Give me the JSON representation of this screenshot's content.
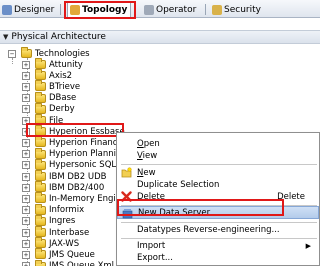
{
  "tabs": [
    {
      "label": "Designer",
      "active": false
    },
    {
      "label": "Topology",
      "active": true
    },
    {
      "label": "Operator",
      "active": false
    },
    {
      "label": "Security",
      "active": false
    }
  ],
  "panel": {
    "title": "Physical Architecture"
  },
  "tree": {
    "root": "Technologies",
    "items": [
      "Attunity",
      "Axis2",
      "BTrieve",
      "DBase",
      "Derby",
      "File",
      "Hyperion Essbase",
      "Hyperion Financial",
      "Hyperion Planning",
      "Hypersonic SQL",
      "IBM DB2 UDB",
      "IBM DB2/400",
      "In-Memory Engine",
      "Informix",
      "Ingres",
      "Interbase",
      "JAX-WS",
      "JMS Queue",
      "JMS Queue Xml"
    ],
    "selected": "Hyperion Essbase"
  },
  "menu": {
    "items": [
      {
        "label": "Open",
        "key": "O"
      },
      {
        "label": "View",
        "key": "V"
      },
      {
        "label": "New",
        "key": "N"
      },
      {
        "label": "Duplicate Selection"
      },
      {
        "label": "Delete",
        "key": "D",
        "shortcut": "Delete"
      },
      {
        "label": "New Data Server",
        "selected": true
      },
      {
        "label": "Datatypes Reverse-engineering..."
      },
      {
        "label": "Import",
        "submenu": true
      },
      {
        "label": "Export..."
      }
    ]
  },
  "colors": {
    "highlight_box": "#e01818",
    "selection": "#b3cbeb",
    "folder": "#f2cf52"
  }
}
